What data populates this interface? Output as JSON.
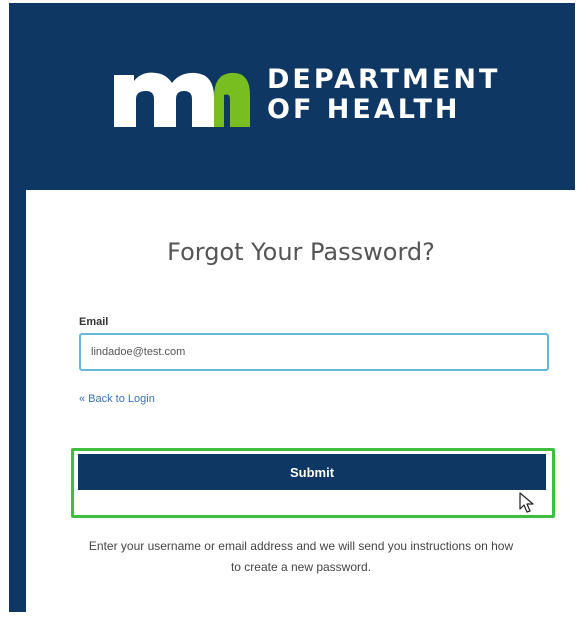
{
  "header": {
    "dept_line1": "DEPARTMENT",
    "dept_line2": "OF HEALTH",
    "logo_icon": "mn-logo-icon",
    "colors": {
      "navy": "#0f3763",
      "green": "#78be20",
      "white": "#ffffff"
    }
  },
  "form": {
    "title": "Forgot Your Password?",
    "email_label": "Email",
    "email_value": "lindadoe@test.com",
    "back_link": "« Back to Login",
    "submit_label": "Submit",
    "instructions": "Enter your username or email address and we will send you instructions on how to create a new password."
  },
  "highlight_color": "#3fbf3f",
  "cursor_icon": "mouse-pointer-icon"
}
